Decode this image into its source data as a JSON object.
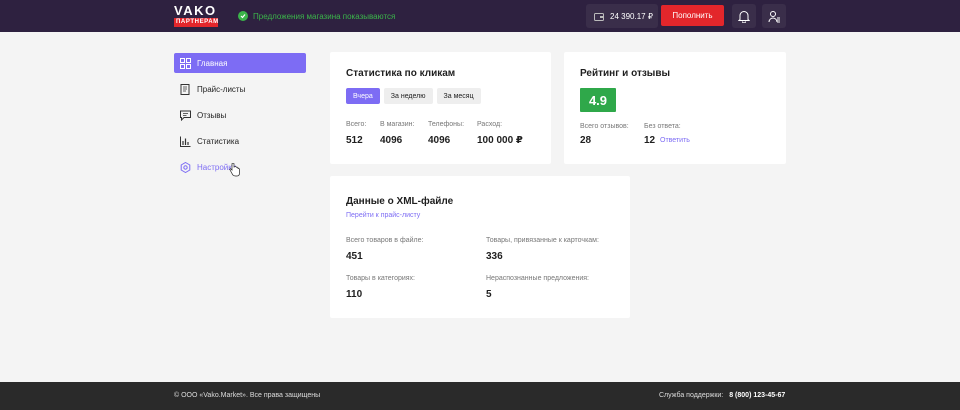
{
  "header": {
    "logo_text": "VAKO",
    "logo_badge": "ПАРТНЕРАМ",
    "shop_status": "Предложения магазина показываются",
    "balance": "24 390.17 ₽",
    "topup_label": "Пополнить"
  },
  "sidebar": {
    "items": [
      {
        "label": "Главная",
        "icon": "grid-icon"
      },
      {
        "label": "Прайс-листы",
        "icon": "price-list-icon"
      },
      {
        "label": "Отзывы",
        "icon": "chat-icon"
      },
      {
        "label": "Статистика",
        "icon": "bar-chart-icon"
      },
      {
        "label": "Настройки",
        "icon": "gear-icon"
      }
    ]
  },
  "clicks": {
    "title": "Статистика по кликам",
    "tabs": [
      "Вчера",
      "За неделю",
      "За месяц"
    ],
    "stats": [
      {
        "label": "Всего:",
        "value": "512"
      },
      {
        "label": "В магазин:",
        "value": "4096"
      },
      {
        "label": "Телефоны:",
        "value": "4096"
      },
      {
        "label": "Расход:",
        "value": "100 000 ₽"
      }
    ]
  },
  "rating": {
    "title": "Рейтинг и отзывы",
    "score": "4.9",
    "total_label": "Всего отзывов:",
    "total_value": "28",
    "unanswered_label": "Без ответа:",
    "unanswered_value": "12",
    "reply_link": "Ответить"
  },
  "xml": {
    "title": "Данные о XML-файле",
    "link": "Перейти к прайс-листу",
    "stats": [
      {
        "label": "Всего товаров в файле:",
        "value": "451"
      },
      {
        "label": "Товары, привязанные к карточкам:",
        "value": "336"
      },
      {
        "label": "Товары в категориях:",
        "value": "110"
      },
      {
        "label": "Нераспознанные предложения:",
        "value": "5"
      }
    ]
  },
  "footer": {
    "copyright": "© ООО «Vako.Market». Все права защищены",
    "support_label": "Служба поддержки:",
    "support_phone": "8 (800) 123-45-67"
  },
  "colors": {
    "header_bg": "#2e2140",
    "accent": "#7d6cf4",
    "red": "#e3262b",
    "green": "#2fa84a"
  }
}
